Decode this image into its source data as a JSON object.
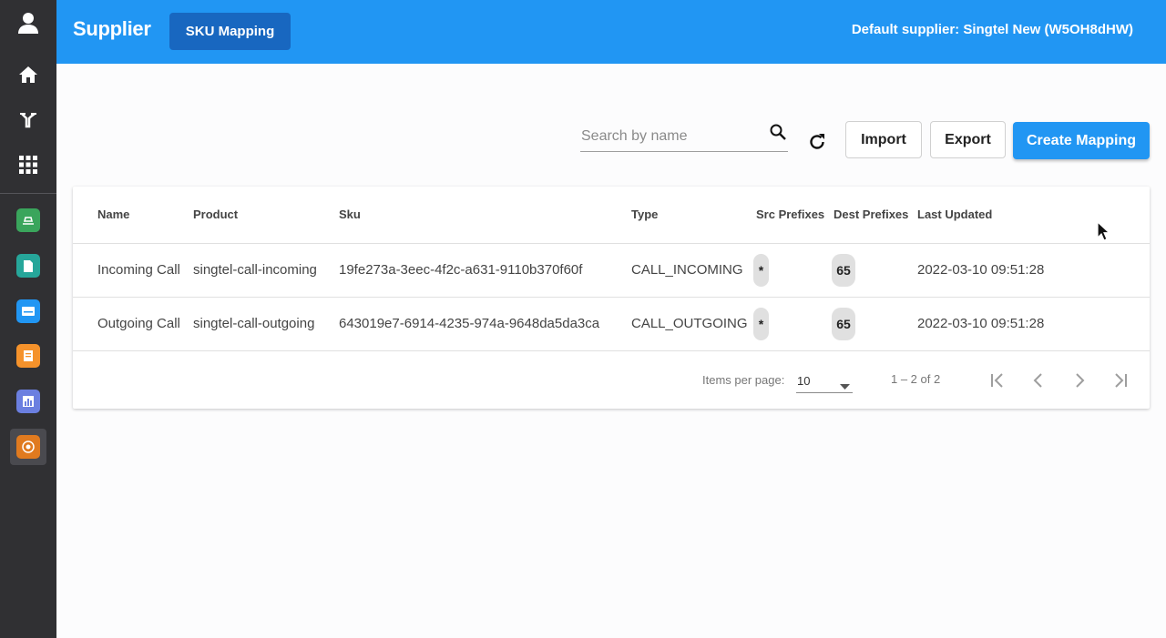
{
  "sidebar": {
    "icons": [
      "user-icon",
      "home-icon",
      "routing-icon",
      "apps-grid-icon"
    ],
    "apps": [
      {
        "icon": "app-green-icon",
        "color": "#3aa55c"
      },
      {
        "icon": "app-teal-document-icon",
        "color": "#26a69a"
      },
      {
        "icon": "app-blue-card-icon",
        "color": "#2196f3"
      },
      {
        "icon": "app-orange-invoice-icon",
        "color": "#f5922b"
      },
      {
        "icon": "app-purple-analytics-icon",
        "color": "#6b7fe0"
      },
      {
        "icon": "app-supplier-icon",
        "color": "#e07a1f",
        "active": true
      }
    ]
  },
  "header": {
    "title": "Supplier",
    "tab_label": "SKU Mapping",
    "default_supplier": "Default supplier: Singtel New (W5OH8dHW)",
    "color": "#2196f3"
  },
  "toolbar": {
    "search_placeholder": "Search by name",
    "search_value": "",
    "import_label": "Import",
    "export_label": "Export",
    "create_label": "Create Mapping"
  },
  "table": {
    "columns": {
      "name": "Name",
      "product": "Product",
      "sku": "Sku",
      "type": "Type",
      "src": "Src Prefixes",
      "dest": "Dest Prefixes",
      "updated": "Last Updated"
    },
    "rows": [
      {
        "name": "Incoming Call",
        "product": "singtel-call-incoming",
        "sku": "19fe273a-3eec-4f2c-a631-9110b370f60f",
        "type": "CALL_INCOMING",
        "src": "*",
        "dest": "65",
        "updated": "2022-03-10 09:51:28"
      },
      {
        "name": "Outgoing Call",
        "product": "singtel-call-outgoing",
        "sku": "643019e7-6914-4235-974a-9648da5da3ca",
        "type": "CALL_OUTGOING",
        "src": "*",
        "dest": "65",
        "updated": "2022-03-10 09:51:28"
      }
    ]
  },
  "paginator": {
    "items_per_page_label": "Items per page:",
    "items_per_page": "10",
    "range": "1 – 2 of 2"
  }
}
